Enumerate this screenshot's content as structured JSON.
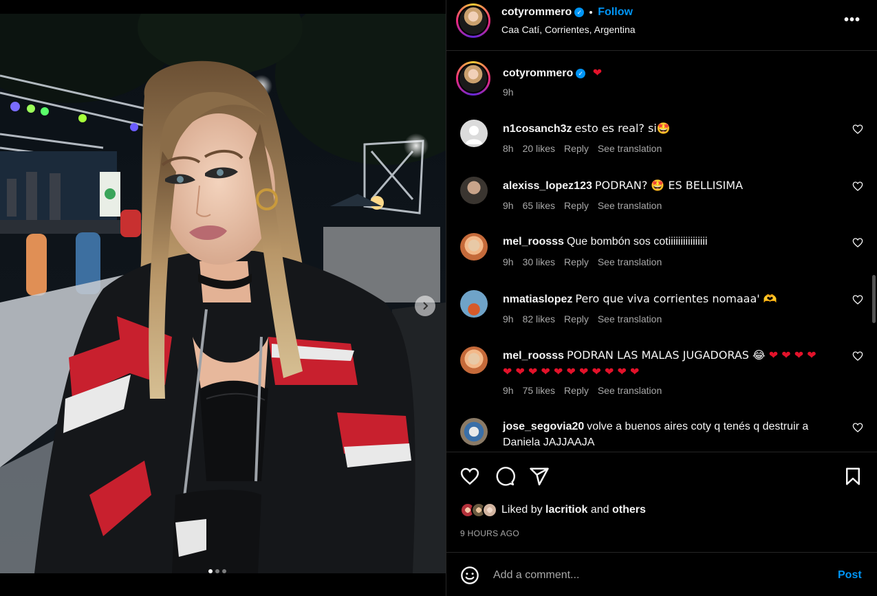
{
  "post": {
    "username": "cotyrommero",
    "follow_label": "Follow",
    "location": "Caa Catí, Corrientes, Argentina",
    "caption_text": "❤",
    "caption_time": "9h"
  },
  "comments": [
    {
      "user": "n1cosanch3z",
      "text": "esto es real? si🤩",
      "time": "8h",
      "likes": "20 likes",
      "reply": "Reply",
      "translate": "See translation"
    },
    {
      "user": "alexiss_lopez123",
      "text": "PODRAN? 🤩 ES BELLISIMA",
      "time": "9h",
      "likes": "65 likes",
      "reply": "Reply",
      "translate": "See translation"
    },
    {
      "user": "mel_roosss",
      "text": "Que bombón sos cotiiiiiiiiiiiiiiii",
      "time": "9h",
      "likes": "30 likes",
      "reply": "Reply",
      "translate": "See translation"
    },
    {
      "user": "nmatiaslopez",
      "text": "Pero que viva corrientes nomaaa' 🫶",
      "time": "9h",
      "likes": "82 likes",
      "reply": "Reply",
      "translate": "See translation"
    },
    {
      "user": "mel_roosss",
      "text": "PODRAN LAS MALAS JUGADORAS 😂 ❤ ❤ ❤ ❤ ❤ ❤ ❤ ❤ ❤ ❤ ❤ ❤ ❤ ❤ ❤",
      "time": "9h",
      "likes": "75 likes",
      "reply": "Reply",
      "translate": "See translation"
    },
    {
      "user": "jose_segovia20",
      "text": "volve a buenos aires coty q tenés q destruir a Daniela JAJJAAJA",
      "time": "",
      "likes": "",
      "reply": "",
      "translate": ""
    }
  ],
  "likes": {
    "prefix": "Liked by",
    "user": "lacritiok",
    "and": "and",
    "others": "others"
  },
  "time_ago": "9 HOURS AGO",
  "add_comment": {
    "placeholder": "Add a comment...",
    "post_label": "Post"
  },
  "colors": {
    "accent": "#0095f6",
    "background": "#000000",
    "secondary_text": "#a8a8a8",
    "divider": "#262626"
  },
  "carousel": {
    "current_index": 1,
    "total": 3
  }
}
